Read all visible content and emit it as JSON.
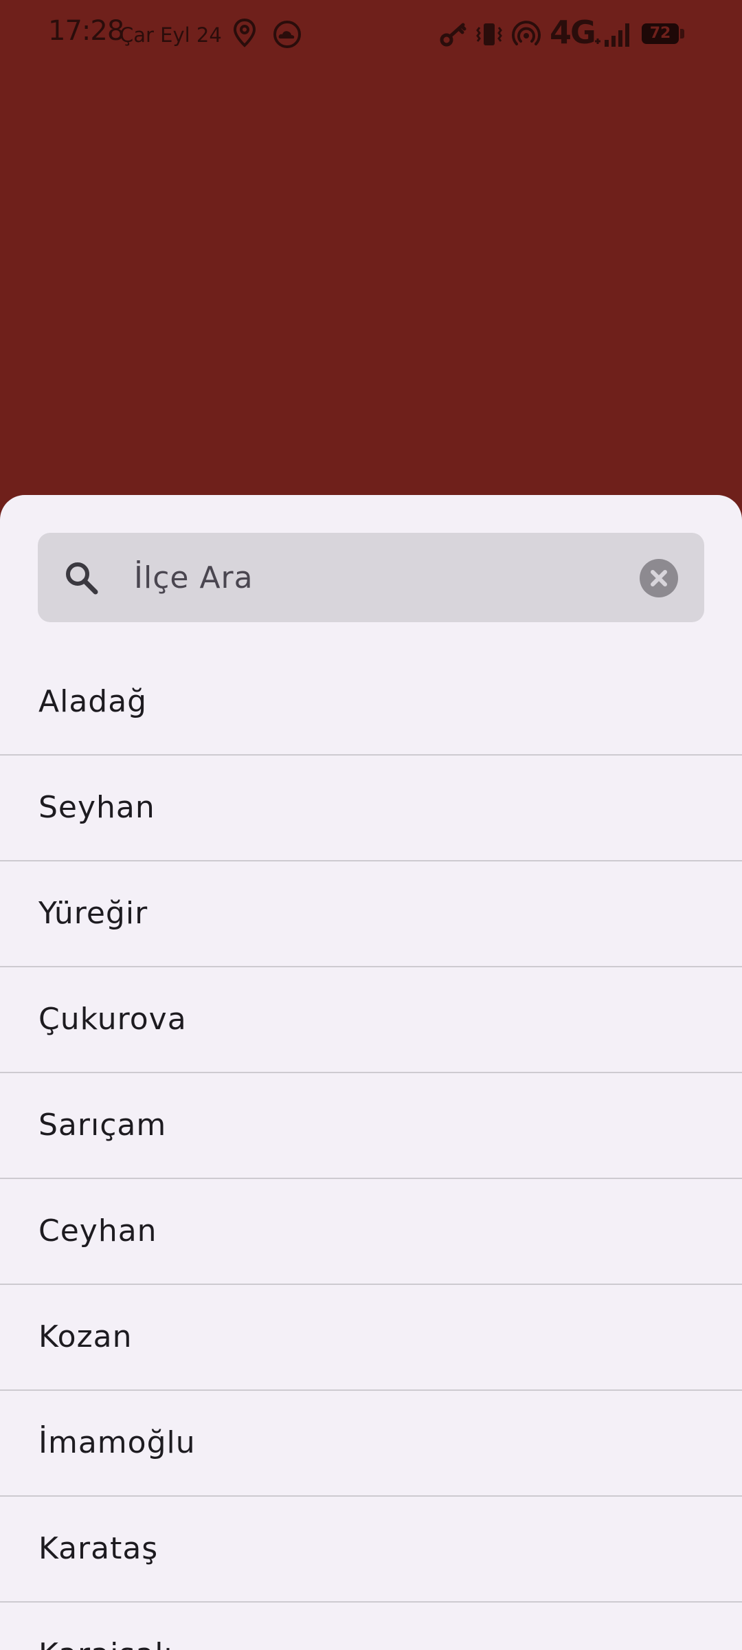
{
  "status_bar": {
    "time": "17:28",
    "date": "Çar Eyl 24",
    "network": "4G",
    "battery": "72",
    "icons": [
      "location-icon",
      "weather-icon",
      "key-icon",
      "vibrate-icon",
      "hotspot-icon",
      "signal-icon",
      "battery-icon"
    ]
  },
  "colors": {
    "background": "#6f201b",
    "sheet": "#f4f0f7",
    "search_field": "#d8d5db",
    "divider": "#cdcad0",
    "text": "#1d1b20"
  },
  "search": {
    "placeholder": "İlçe Ara",
    "value": "",
    "icon": "search-icon",
    "clear_icon": "clear-icon"
  },
  "districts": [
    "Aladağ",
    "Seyhan",
    "Yüreğir",
    "Çukurova",
    "Sarıçam",
    "Ceyhan",
    "Kozan",
    "İmamoğlu",
    "Karataş",
    "Karaisalı"
  ]
}
